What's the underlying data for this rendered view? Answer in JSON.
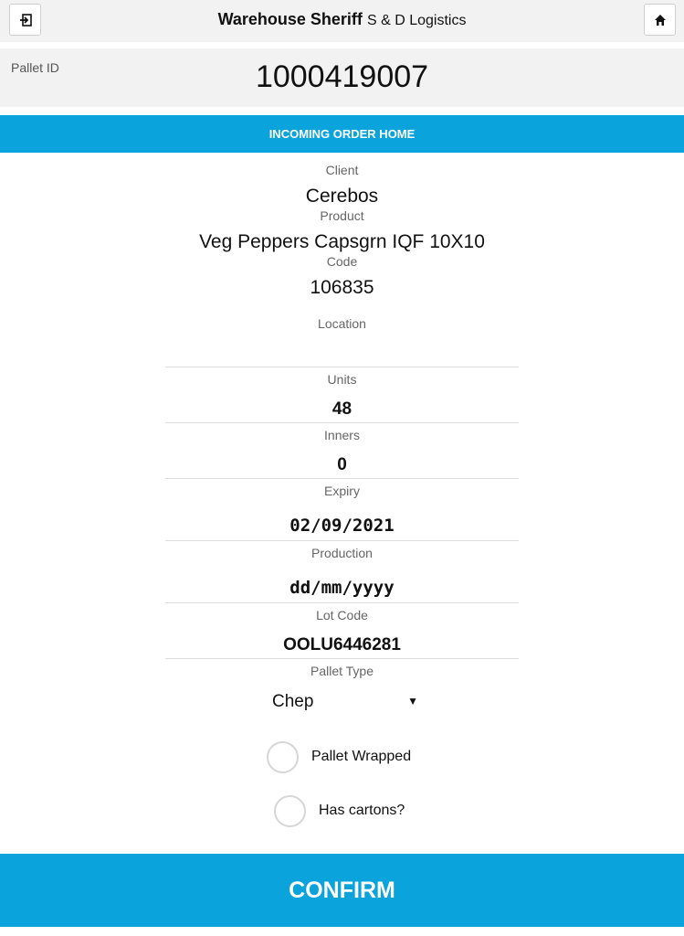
{
  "header": {
    "title_bold": "Warehouse Sheriff",
    "title_sub": "S & D Logistics",
    "left_icon": "login-icon",
    "right_icon": "home-icon"
  },
  "pallet": {
    "label": "Pallet ID",
    "value": "1000419007"
  },
  "section_title": "INCOMING ORDER HOME",
  "fields": {
    "client": {
      "label": "Client",
      "value": "Cerebos"
    },
    "product": {
      "label": "Product",
      "value": "Veg Peppers Capsgrn IQF 10X10"
    },
    "code": {
      "label": "Code",
      "value": "106835"
    },
    "location": {
      "label": "Location",
      "value": ""
    },
    "units": {
      "label": "Units",
      "value": "48"
    },
    "inners": {
      "label": "Inners",
      "value": "0"
    },
    "expiry": {
      "label": "Expiry",
      "value": "02/09/2021"
    },
    "production": {
      "label": "Production",
      "value": "dd/mm/yyyy"
    },
    "lot_code": {
      "label": "Lot Code",
      "value": "OOLU6446281"
    },
    "pallet_type": {
      "label": "Pallet Type",
      "value": "Chep"
    }
  },
  "checks": {
    "pallet_wrapped": "Pallet Wrapped",
    "has_cartons": "Has cartons?"
  },
  "confirm_label": "CONFIRM",
  "colors": {
    "accent": "#0aa3dc",
    "header_bg": "#f2f2f2"
  }
}
